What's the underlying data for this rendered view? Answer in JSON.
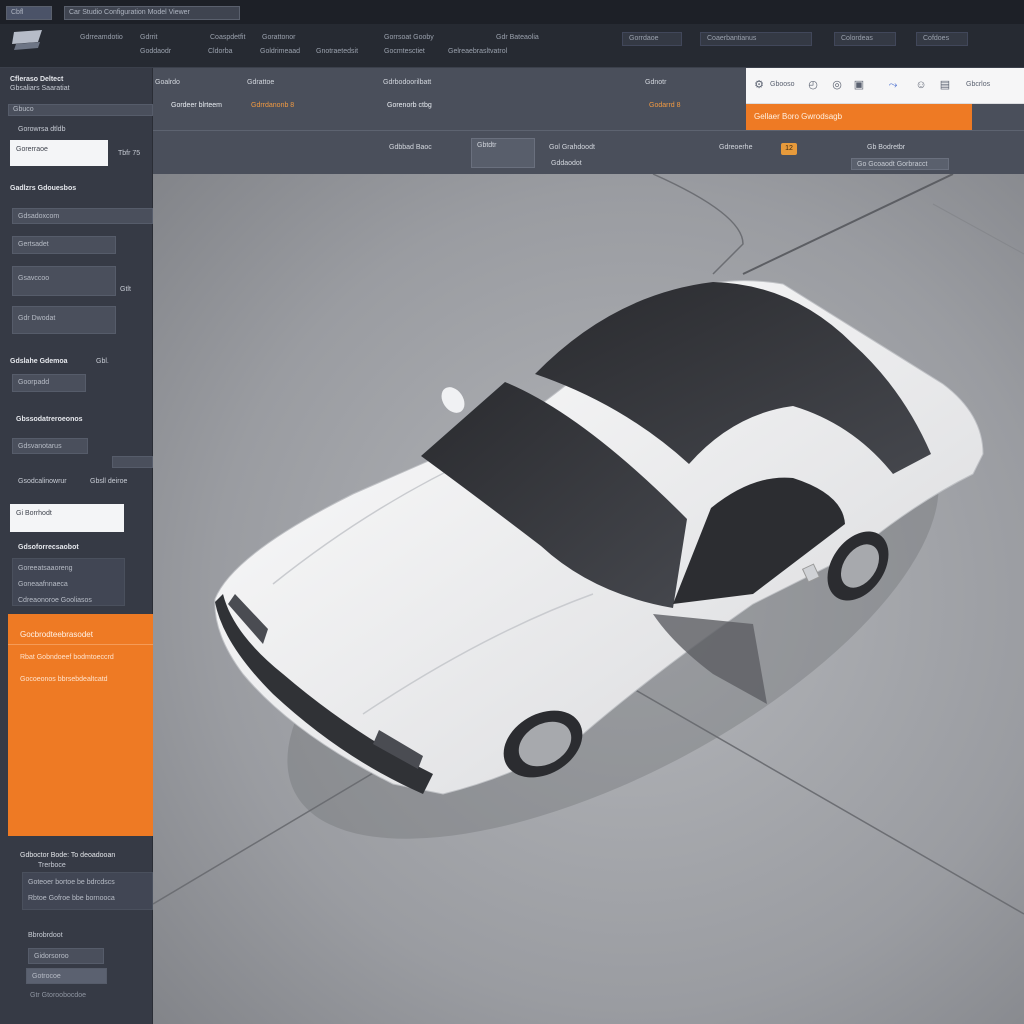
{
  "titlebar": {
    "tab1": "Cbfl",
    "tab2": "Car Studio Configuration Model Viewer"
  },
  "header": {
    "links": [
      "Gdrreamdotio",
      "Gdrrit",
      "Coaspdetfit",
      "Gorattonor",
      "Gorrsoat Gooby",
      "Gdr Bateaolia"
    ],
    "sublinks": [
      "Goddaodr",
      "Cldorba",
      "Goldrimeaad",
      "Gnotraetedsit",
      "Gocmtesctiet",
      "Gelreaebrasltvatrol"
    ],
    "pills": [
      "Gorrdaoe",
      "Coaerbantianus",
      "Colordeas",
      "Cofdoes"
    ]
  },
  "sidebar": {
    "app_title": "Cfleraso Deltect",
    "app_subtitle": "Gbsaliars Saaratiat",
    "tag": "Gbuco",
    "filter_label": "Gorowrsa dtldb",
    "search_value": "Gorerraoe",
    "search_aside": "Tbfr 75",
    "section1": "Gadlzrs Gdouesbos",
    "fields": [
      "Gdsadoxcom",
      "Gertsadet",
      "Gsavccoo",
      "Gdr Dwodat"
    ],
    "field_aside": "Gtlt",
    "section2": "Gdslahe Gdemoa",
    "section2_aside": "Gbl.",
    "row_label": "Goorpadd",
    "section3": "Gbssodatreroeonos",
    "row2": "Gdsvanotarus",
    "row3": "Gsodcalinowrur",
    "row3_aside": "Gbsll deiroe",
    "white_btn": "Gi Borrhodt",
    "section4": "Gdsoforrecsaobot",
    "list": [
      "Goreeatsaaoreng",
      "Goneaafnnaeca",
      "Cdreaonoroe Gooliasos"
    ],
    "orange_card": {
      "title": "Gocbrodteebrasodet",
      "line1": "Rbat Gobndoeef bodmtoeccrd",
      "line2": "Gocoeonos bbrsebdealtcatd"
    },
    "footer_title": "Gdboctor Bode: To deoadooan",
    "footer_sub": "Trerboce",
    "footer_rows": [
      "Goteoer bortoe be bdrcdscs",
      "Rbtoe Gofroe bbe bornooca"
    ],
    "footer_label": "Bbrobrdoot",
    "footer_fields": [
      "Gidorsoroo",
      "Gotrocoe"
    ],
    "footer_last": "Gtr Gtoroobocdoe"
  },
  "infobar": {
    "col_labels": [
      "Goalrdo",
      "Gdrattoe",
      "Gdrbodoorilbatt",
      "Gdnotr"
    ],
    "col_values": [
      "Gordeer blrteem",
      "Gdrrdanonb 8",
      "Gorenorb ctbg",
      "Godarrd 8"
    ],
    "row2_items": [
      "Gdbbad Baoc",
      "Gbtdtr",
      "Gol Grahdoodt",
      "Gddaodot",
      "Gdreoerhe",
      "Gb Bodretbr"
    ],
    "badge": "12",
    "row2_field": "Go Gcoaodt Gorbracct",
    "toolbar_text1": "Gbooso",
    "toolbar_text2": "Gbcrlos",
    "orange_button": "Gellaer Boro Gwrodsagb"
  },
  "icons": [
    "logo-icon",
    "settings-icon",
    "camera-icon",
    "share-icon",
    "user-icon",
    "chart-icon"
  ],
  "colors": {
    "accent": "#ee7a24",
    "sidebar": "#363a45",
    "viewport_floor": "#9a9da2"
  }
}
